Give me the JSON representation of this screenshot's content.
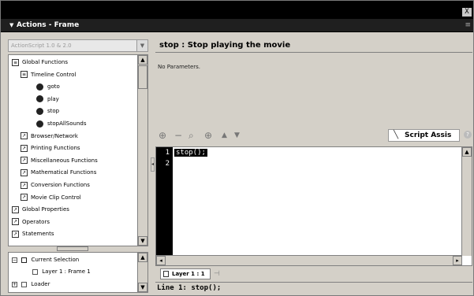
{
  "window": {
    "close_label": "X",
    "title": "Actions - Frame"
  },
  "left_panel": {
    "version_select": "ActionScript 1.0 & 2.0",
    "tree_items": [
      {
        "label": "Global Functions",
        "indent": 0,
        "icon": "book-open-icon"
      },
      {
        "label": "Timeline Control",
        "indent": 1,
        "icon": "book-open-icon"
      },
      {
        "label": "goto",
        "indent": 2,
        "icon": "action-circle-icon"
      },
      {
        "label": "play",
        "indent": 2,
        "icon": "action-circle-icon"
      },
      {
        "label": "stop",
        "indent": 2,
        "icon": "action-circle-icon"
      },
      {
        "label": "stopAllSounds",
        "indent": 2,
        "icon": "action-circle-icon"
      },
      {
        "label": "Browser/Network",
        "indent": 1,
        "icon": "book-closed-icon"
      },
      {
        "label": "Printing Functions",
        "indent": 1,
        "icon": "book-closed-icon"
      },
      {
        "label": "Miscellaneous Functions",
        "indent": 1,
        "icon": "book-closed-icon"
      },
      {
        "label": "Mathematical Functions",
        "indent": 1,
        "icon": "book-closed-icon"
      },
      {
        "label": "Conversion Functions",
        "indent": 1,
        "icon": "book-closed-icon"
      },
      {
        "label": "Movie Clip Control",
        "indent": 1,
        "icon": "book-closed-icon"
      },
      {
        "label": "Global Properties",
        "indent": 0,
        "icon": "book-closed-icon"
      },
      {
        "label": "Operators",
        "indent": 0,
        "icon": "book-closed-icon"
      },
      {
        "label": "Statements",
        "indent": 0,
        "icon": "book-closed-icon"
      }
    ],
    "scene_tree": {
      "current_selection": "Current Selection",
      "layer_frame": "Layer 1 : Frame 1",
      "loader": "Loader"
    }
  },
  "right_panel": {
    "header": "stop : Stop playing the movie",
    "params": "No Parameters.",
    "toolbar_icons": [
      "add-icon",
      "delete-icon",
      "find-icon",
      "target-icon",
      "up-icon",
      "down-icon"
    ],
    "script_assist": "Script Assis",
    "help": "?",
    "code_lines": [
      {
        "num": "1",
        "text": "stop();"
      },
      {
        "num": "2",
        "text": ""
      }
    ],
    "layer_tab": "Layer 1 : 1",
    "status": "Line 1: stop();"
  }
}
